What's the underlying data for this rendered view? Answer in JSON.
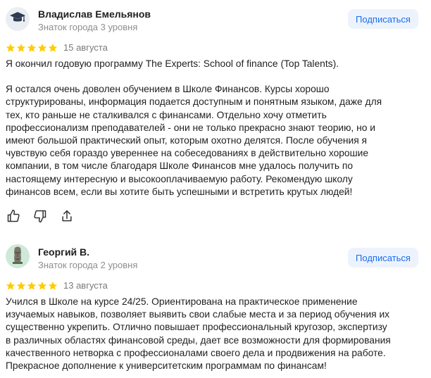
{
  "reviews": [
    {
      "author": "Владислав Емельянов",
      "level": "Знаток города 3 уровня",
      "subscribe_label": "Подписаться",
      "avatar_icon": "graduation-cap-icon",
      "rating": 5,
      "date": "15 августа",
      "paragraphs": [
        "Я окончил годовую программу The Experts: School of finance (Top Talents).",
        "Я остался очень доволен обучением в Школе Финансов. Курсы хорошо\nструктурированы, информация подается доступным и понятным языком, даже для\nтех, кто раньше не сталкивался с финансами. Отдельно хочу отметить\nпрофессионализм преподавателей - они не только прекрасно знают теорию, но и\nимеют большой практический опыт, которым охотно делятся. После обучения я\nчувствую себя гораздо увереннее на собеседованиях в действительно хорошие\nкомпании, в том числе благодаря Школе Финансов мне удалось получить по\nнастоящему интересную и высокооплачиваемую работу. Рекомендую школу\nфинансов всем, если вы хотите быть успешными и встретить крутых людей!"
      ],
      "actions": [
        "like-icon",
        "dislike-icon",
        "share-icon"
      ]
    },
    {
      "author": "Георгий В.",
      "level": "Знаток города 2 уровня",
      "subscribe_label": "Подписаться",
      "avatar_icon": "moai-statue-icon",
      "rating": 5,
      "date": "13 августа",
      "paragraphs": [
        "Учился в Школе на курсе 24/25. Ориентирована на практическое применение\nизучаемых навыков, позволяет выявить свои слабые места и за период обучения их\nсущественно укрепить. Отлично повышает профессиональный кругозор, экспертизу\nв различных областях финансовой среды, дает все возможности для формирования\nкачественного нетворка с профессионалами своего дела и продвижения на работе.\nПрекрасное дополнение к университетским программам по финансам!"
      ]
    }
  ],
  "colors": {
    "star": "#fc0",
    "subscribe_bg": "#edf3fd",
    "subscribe_text": "#1a6df0",
    "muted": "#8e8e8e"
  }
}
